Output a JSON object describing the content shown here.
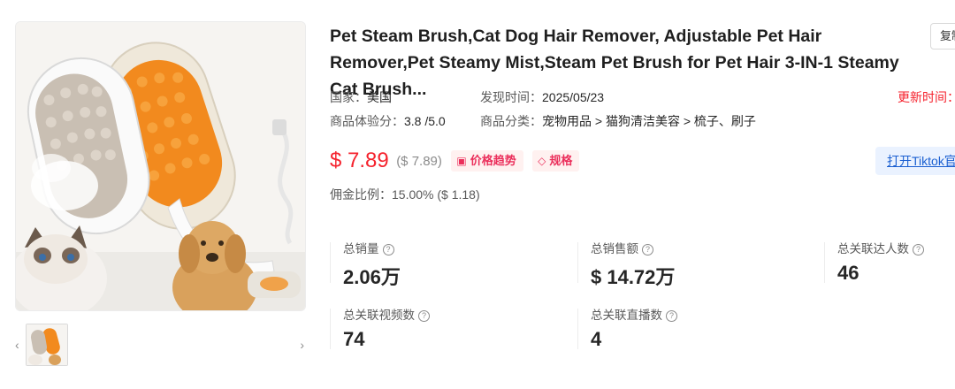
{
  "product": {
    "title": "Pet Steam Brush,Cat Dog Hair Remover, Adjustable Pet Hair Remover,Pet Steamy Mist,Steam Pet Brush for Pet Hair 3-IN-1 Steamy Cat Brush...",
    "copy_label": "复制"
  },
  "meta": {
    "country_label": "国家：",
    "country": "美国",
    "discovered_label": "发现时间：",
    "discovered": "2025/05/23",
    "update_label": "更新时间：",
    "rating_label": "商品体验分：",
    "rating": "3.8 /5.0",
    "category_label": "商品分类：",
    "category": "宠物用品 > 猫狗清洁美容 > 梳子、刷子"
  },
  "price": {
    "current": "$ 7.89",
    "original": "($ 7.89)",
    "trend_label": "价格趋势",
    "spec_label": "规格",
    "open_tiktok_label": "打开Tiktok官网",
    "commission_label": "佣金比例：",
    "commission": "15.00% ($ 1.18)"
  },
  "stats": [
    {
      "label": "总销量",
      "value": "2.06万"
    },
    {
      "label": "总销售额",
      "value": "$ 14.72万"
    },
    {
      "label": "总关联达人数",
      "value": "46"
    },
    {
      "label": "总关联视频数",
      "value": "74"
    },
    {
      "label": "总关联直播数",
      "value": "4"
    }
  ],
  "gallery": {
    "prev": "‹",
    "next": "›"
  }
}
